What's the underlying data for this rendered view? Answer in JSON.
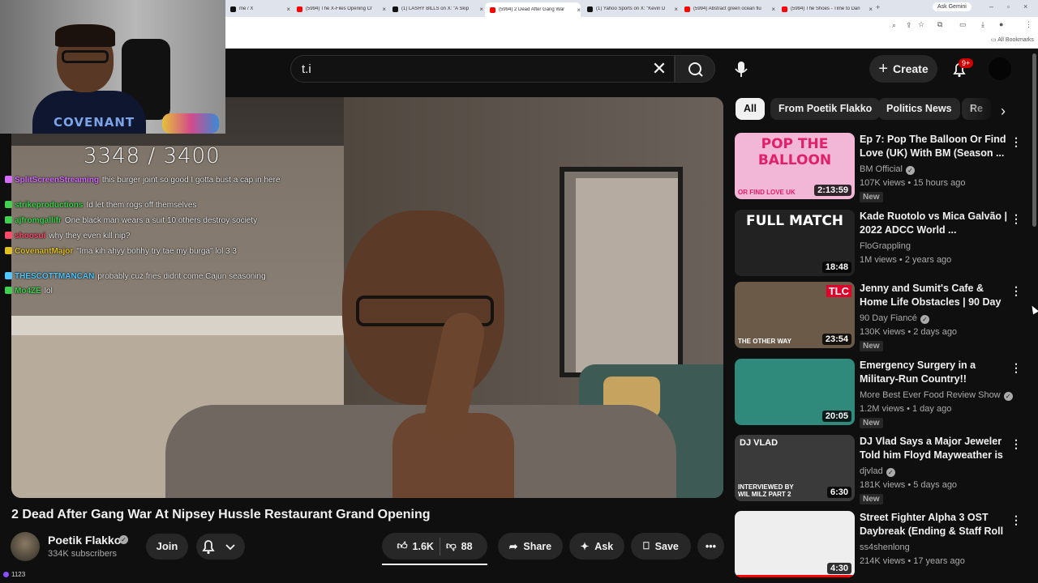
{
  "browser": {
    "tabs": [
      {
        "label": "me / X",
        "favicon": "x-icon"
      },
      {
        "label": "(5994) The X-Files Opening Cr",
        "favicon": "youtube-icon"
      },
      {
        "label": "(1) LASHY BILLS on X: \"A Skip",
        "favicon": "x-icon"
      },
      {
        "label": "(5994) 2 Dead After Gang War",
        "favicon": "youtube-icon",
        "active": true
      },
      {
        "label": "(1) Yahoo Sports on X: \"Kevin D",
        "favicon": "x-icon"
      },
      {
        "label": "(5994) Abstract green ocean flu",
        "favicon": "youtube-icon"
      },
      {
        "label": "(5994) The Shoes - Time to Dan",
        "favicon": "youtube-icon"
      }
    ],
    "ask_gemini": "Ask Gemini",
    "all_bookmarks": "All Bookmarks"
  },
  "header": {
    "search_value": "t.i",
    "create_label": "Create",
    "notification_badge": "9+"
  },
  "stream_overlay": {
    "goal": "3348 / 3400",
    "shirt_text": "COVENANT",
    "viewer_count": "1123",
    "chat": [
      {
        "user": "SplitScreenStreaming",
        "user_color": "#d66cff",
        "text": "this burger joint so good I gotta bust a cap in here"
      },
      {
        "user": "strikeproductions",
        "user_color": "#3fd14f",
        "text": "Id let them rogs off themselves"
      },
      {
        "user": "ajfromgallifr",
        "user_color": "#3fd14f",
        "text": "One black man wears a suit 10 others destroy society"
      },
      {
        "user": "shoosui",
        "user_color": "#ff4a6a",
        "text": "why they even kill nip?"
      },
      {
        "user": "CovenantMajor",
        "user_color": "#e0c020",
        "text": "\"Ima kih ahyy bohhy try tae my burga\" lol 3 3"
      },
      {
        "user": "THESCOTTMANCAN",
        "user_color": "#4fc8ff",
        "text": "probably cuz fries didnt come Cajun seasoning"
      },
      {
        "user": "Mo4ZE",
        "user_color": "#3fd14f",
        "text": "lol"
      }
    ]
  },
  "video": {
    "title": "2 Dead After Gang War At Nipsey Hussle Restaurant Grand Opening",
    "channel": "Poetik Flakko",
    "subscribers": "334K subscribers",
    "join_label": "Join",
    "likes": "1.6K",
    "dislikes": "88",
    "share_label": "Share",
    "ask_label": "Ask",
    "save_label": "Save"
  },
  "chips": [
    "All",
    "From Poetik Flakko",
    "Politics News",
    "Re"
  ],
  "recommendations": [
    {
      "title": "Ep 7: Pop The Balloon Or Find Love (UK) With BM (Season ...",
      "channel": "BM Official",
      "verified": true,
      "views": "107K views",
      "age": "15 hours ago",
      "badge": "New",
      "duration": "2:13:59",
      "thumb_text": "POP THE BALLOON",
      "thumb_sub": "OR FIND LOVE UK",
      "thumb_bg": "#f2b6d6"
    },
    {
      "title": "Kade Ruotolo vs Mica Galvão | 2022 ADCC World ...",
      "channel": "FloGrappling",
      "verified": false,
      "views": "1M views",
      "age": "2 years ago",
      "badge": "",
      "duration": "18:48",
      "thumb_text": "FULL MATCH",
      "thumb_sub": "",
      "thumb_bg": "#222222"
    },
    {
      "title": "Jenny and Sumit's Cafe & Home Life Obstacles | 90 Day Fiancé:...",
      "channel": "90 Day Fiancé",
      "verified": true,
      "views": "130K views",
      "age": "2 days ago",
      "badge": "New",
      "duration": "23:54",
      "thumb_text": "TLC",
      "thumb_sub": "THE OTHER WAY",
      "thumb_bg": "#6b5a48"
    },
    {
      "title": "Emergency Surgery in a Military-Run Country!!",
      "channel": "More Best Ever Food Review Show",
      "verified": true,
      "views": "1.2M views",
      "age": "1 day ago",
      "badge": "New",
      "duration": "20:05",
      "thumb_text": "",
      "thumb_sub": "",
      "thumb_bg": "#2f8a7c"
    },
    {
      "title": "DJ Vlad Says a Major Jeweler Told him Floyd Mayweather is ...",
      "channel": "djvlad",
      "verified": true,
      "views": "181K views",
      "age": "5 days ago",
      "badge": "New",
      "duration": "6:30",
      "thumb_text": "DJ VLAD",
      "thumb_sub": "INTERVIEWED BY WIL MILZ PART 2",
      "thumb_bg": "#3a3a3a"
    },
    {
      "title": "Street Fighter Alpha 3 OST Daybreak (Ending & Staff Roll ...",
      "channel": "ss4shenlong",
      "verified": false,
      "views": "214K views",
      "age": "17 years ago",
      "badge": "",
      "duration": "4:30",
      "thumb_text": "",
      "thumb_sub": "",
      "thumb_bg": "#eeeeee"
    }
  ]
}
